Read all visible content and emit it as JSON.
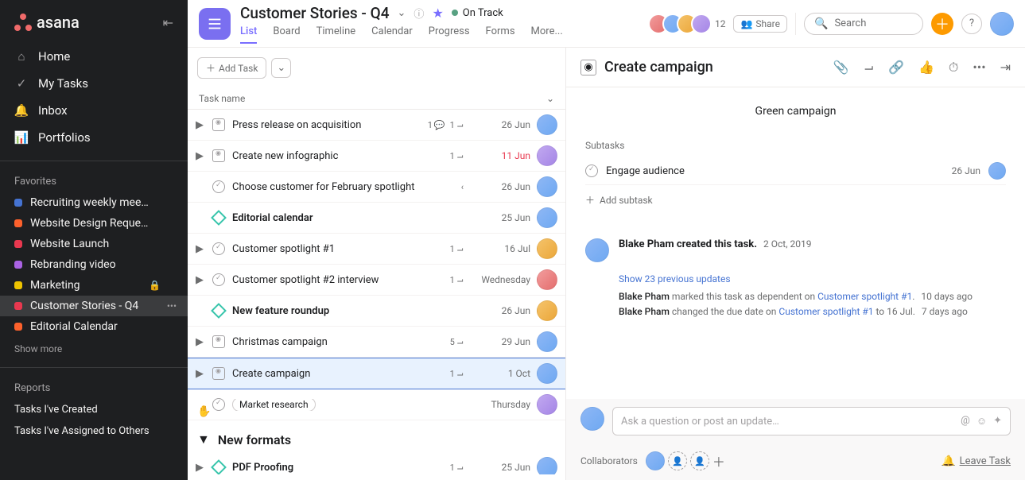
{
  "brand": "asana",
  "header": {
    "project_title": "Customer Stories - Q4",
    "status": "On Track",
    "tabs": [
      "List",
      "Board",
      "Timeline",
      "Calendar",
      "Progress",
      "Forms",
      "More..."
    ],
    "active_tab": 0,
    "member_count": "12",
    "share_label": "Share",
    "search_placeholder": "Search"
  },
  "sidebar": {
    "nav": [
      {
        "label": "Home",
        "icon": "home-icon"
      },
      {
        "label": "My Tasks",
        "icon": "check-circle-icon"
      },
      {
        "label": "Inbox",
        "icon": "bell-icon"
      },
      {
        "label": "Portfolios",
        "icon": "chart-icon"
      }
    ],
    "favorites_title": "Favorites",
    "favorites": [
      {
        "label": "Recruiting weekly mee…",
        "color": "#4573d2"
      },
      {
        "label": "Website Design Reque…",
        "color": "#fd612c"
      },
      {
        "label": "Website Launch",
        "color": "#e8384f"
      },
      {
        "label": "Rebranding video",
        "color": "#aa62e3"
      },
      {
        "label": "Marketing",
        "color": "#eec300",
        "locked": true
      },
      {
        "label": "Customer Stories - Q4",
        "color": "#e8384f",
        "active": true,
        "more": true
      },
      {
        "label": "Editorial Calendar",
        "color": "#fd612c"
      }
    ],
    "show_more": "Show more",
    "reports_title": "Reports",
    "reports": [
      "Tasks I've Created",
      "Tasks I've Assigned to Others"
    ]
  },
  "list": {
    "add_task": "Add Task",
    "column_header": "Task name",
    "rows": [
      {
        "type": "task",
        "icon": "approval",
        "name": "Press release on acquisition",
        "has_children": true,
        "comments": "1",
        "subtasks": "1",
        "due": "26 Jun",
        "avatar": "av-a"
      },
      {
        "type": "task",
        "icon": "approval",
        "name": "Create new infographic",
        "has_children": true,
        "subtasks": "1",
        "due": "11 Jun",
        "overdue": true,
        "avatar": "av-d"
      },
      {
        "type": "task",
        "icon": "circle",
        "name": "Choose customer for February spotlight",
        "blocked": true,
        "due": "26 Jun",
        "avatar": "av-a"
      },
      {
        "type": "milestone",
        "name": "Editorial calendar",
        "bold": true,
        "due": "25 Jun",
        "avatar": "av-a"
      },
      {
        "type": "task",
        "icon": "circle",
        "name": "Customer spotlight #1",
        "has_children": true,
        "subtasks": "1",
        "due": "16 Jul",
        "avatar": "av-c"
      },
      {
        "type": "task",
        "icon": "circle",
        "name": "Customer spotlight #2 interview",
        "has_children": true,
        "subtasks": "1",
        "due": "Wednesday",
        "avatar": "av-b"
      },
      {
        "type": "milestone",
        "name": "New feature roundup",
        "bold": true,
        "due": "26 Jun",
        "avatar": "av-c"
      },
      {
        "type": "task",
        "icon": "approval",
        "name": "Christmas campaign",
        "has_children": true,
        "subtasks": "5",
        "due": "29 Jun",
        "avatar": "av-a"
      },
      {
        "type": "task",
        "icon": "approval",
        "name": "Create campaign",
        "has_children": true,
        "subtasks": "1",
        "due": "1 Oct",
        "avatar": "av-a",
        "selected": true
      },
      {
        "type": "task",
        "icon": "circle",
        "name": "Market research",
        "tagged": true,
        "due": "Thursday",
        "avatar": "av-d"
      }
    ],
    "section_title": "New formats",
    "section_rows": [
      {
        "type": "milestone",
        "name": "PDF Proofing",
        "has_children": true,
        "subtasks": "1",
        "due": "25 Jun",
        "avatar": "av-a",
        "bold": true
      }
    ]
  },
  "detail": {
    "title": "Create campaign",
    "description": "Green campaign",
    "subtasks_label": "Subtasks",
    "subtask": {
      "name": "Engage audience",
      "due": "26 Jun"
    },
    "add_subtask": "Add subtask",
    "created_by": "Blake Pham created this task.",
    "created_date": "2 Oct, 2019",
    "show_previous": "Show 23 previous updates",
    "log1_name": "Blake Pham",
    "log1_text": " marked this task as dependent on ",
    "log1_link": "Customer spotlight #1",
    "log1_after": ".",
    "log1_ago": "10 days ago",
    "log2_name": "Blake Pham",
    "log2_text": " changed the due date on ",
    "log2_link": "Customer spotlight #1",
    "log2_after": " to 16 Jul.",
    "log2_ago": "7 days ago",
    "comment_placeholder": "Ask a question or post an update…",
    "collaborators_label": "Collaborators",
    "leave_label": "Leave Task"
  }
}
